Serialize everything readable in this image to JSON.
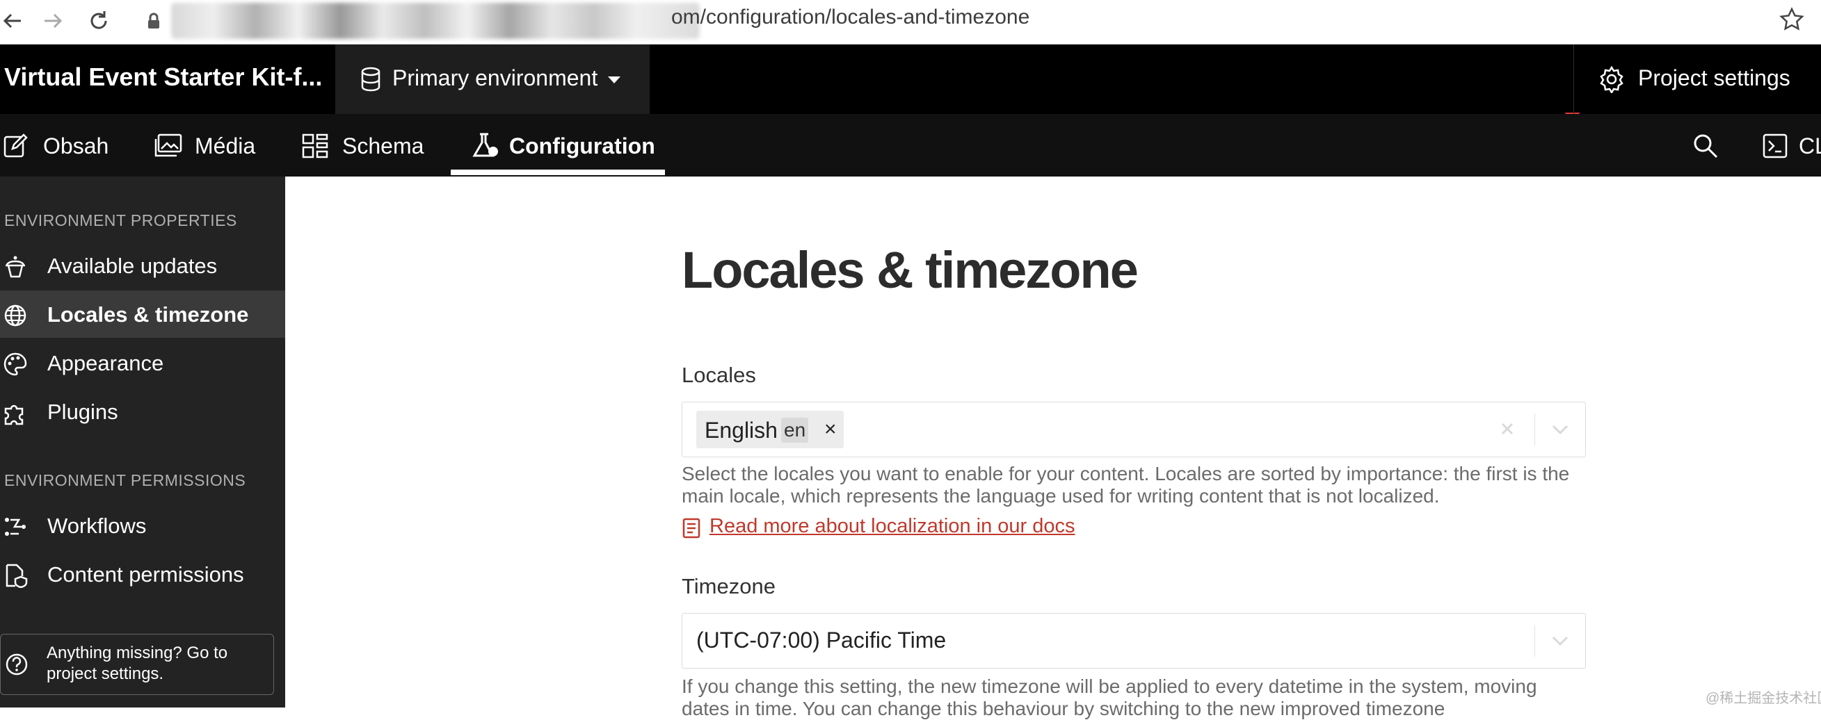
{
  "browser": {
    "url_visible": "om/configuration/locales-and-timezone"
  },
  "header": {
    "project_title": "Virtual Event Starter Kit-f...",
    "environment": "Primary environment",
    "project_settings": "Project settings"
  },
  "tabs": [
    {
      "label": "Obsah",
      "icon": "edit-icon"
    },
    {
      "label": "Média",
      "icon": "image-icon"
    },
    {
      "label": "Schema",
      "icon": "schema-icon"
    },
    {
      "label": "Configuration",
      "icon": "flask-icon",
      "active": true
    }
  ],
  "tab_right": {
    "cli_label": "CL"
  },
  "sidebar": {
    "section1": "ENVIRONMENT PROPERTIES",
    "items1": [
      {
        "label": "Available updates",
        "icon": "cupcake-icon"
      },
      {
        "label": "Locales & timezone",
        "icon": "globe-icon",
        "active": true
      },
      {
        "label": "Appearance",
        "icon": "palette-icon"
      },
      {
        "label": "Plugins",
        "icon": "puzzle-icon"
      }
    ],
    "section2": "ENVIRONMENT PERMISSIONS",
    "items2": [
      {
        "label": "Workflows",
        "icon": "workflow-icon"
      },
      {
        "label": "Content permissions",
        "icon": "shield-file-icon"
      }
    ],
    "missing": "Anything missing? Go to project settings."
  },
  "main": {
    "title": "Locales & timezone",
    "locales_label": "Locales",
    "locale_chip_name": "English",
    "locale_chip_code": "en",
    "locales_help": "Select the locales you want to enable for your content. Locales are sorted by importance: the first is the main locale, which represents the language used for writing content that is not localized.",
    "docs_link": "Read more about localization in our docs",
    "timezone_label": "Timezone",
    "timezone_value": "(UTC-07:00) Pacific Time",
    "timezone_help": "If you change this setting, the new timezone will be applied to every datetime in the system, moving dates in time. You can change this behaviour by switching to the new improved timezone"
  },
  "watermark": "@稀土掘金技术社区",
  "colors": {
    "accent_link": "#c0392b",
    "topbar": "#000000",
    "sidebar": "#232323"
  }
}
